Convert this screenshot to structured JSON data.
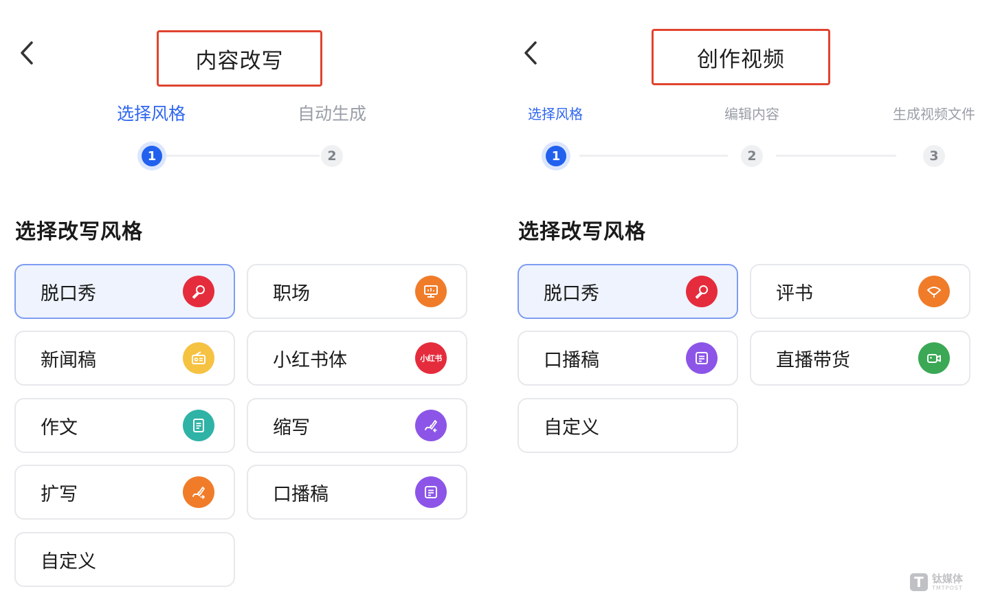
{
  "left": {
    "title": "内容改写",
    "steps": [
      {
        "label": "选择风格",
        "number": "1",
        "active": true
      },
      {
        "label": "自动生成",
        "number": "2",
        "active": false
      }
    ],
    "section_title": "选择改写风格",
    "styles": [
      {
        "label": "脱口秀",
        "icon": "microphone-icon",
        "color": "#e52c3c",
        "selected": true
      },
      {
        "label": "职场",
        "icon": "monitor-icon",
        "color": "#f07c2a",
        "selected": false
      },
      {
        "label": "新闻稿",
        "icon": "radio-icon",
        "color": "#f5c242",
        "selected": false
      },
      {
        "label": "小红书体",
        "icon": "xiaohongshu-icon",
        "icon_text": "小红书",
        "color": "#e52c3c",
        "selected": false
      },
      {
        "label": "作文",
        "icon": "document-icon",
        "color": "#2fb3a6",
        "selected": false
      },
      {
        "label": "缩写",
        "icon": "shrink-pen-icon",
        "color": "#8c55e8",
        "selected": false
      },
      {
        "label": "扩写",
        "icon": "expand-pen-icon",
        "color": "#f07c2a",
        "selected": false
      },
      {
        "label": "口播稿",
        "icon": "script-icon",
        "color": "#8c55e8",
        "selected": false
      },
      {
        "label": "自定义",
        "icon": "",
        "color": "",
        "selected": false
      }
    ]
  },
  "right": {
    "title": "创作视频",
    "steps": [
      {
        "label": "选择风格",
        "number": "1",
        "active": true
      },
      {
        "label": "编辑内容",
        "number": "2",
        "active": false
      },
      {
        "label": "生成视频文件",
        "number": "3",
        "active": false
      }
    ],
    "section_title": "选择改写风格",
    "styles": [
      {
        "label": "脱口秀",
        "icon": "microphone-icon",
        "color": "#e52c3c",
        "selected": true
      },
      {
        "label": "评书",
        "icon": "fan-icon",
        "color": "#f07c2a",
        "selected": false
      },
      {
        "label": "口播稿",
        "icon": "script-icon",
        "color": "#8c55e8",
        "selected": false
      },
      {
        "label": "直播带货",
        "icon": "video-camera-icon",
        "color": "#3aa855",
        "selected": false
      },
      {
        "label": "自定义",
        "icon": "",
        "color": "",
        "selected": false
      }
    ]
  },
  "watermark": {
    "cn": "钛媒体",
    "en": "TMTPOST",
    "logo_letter": "T"
  }
}
